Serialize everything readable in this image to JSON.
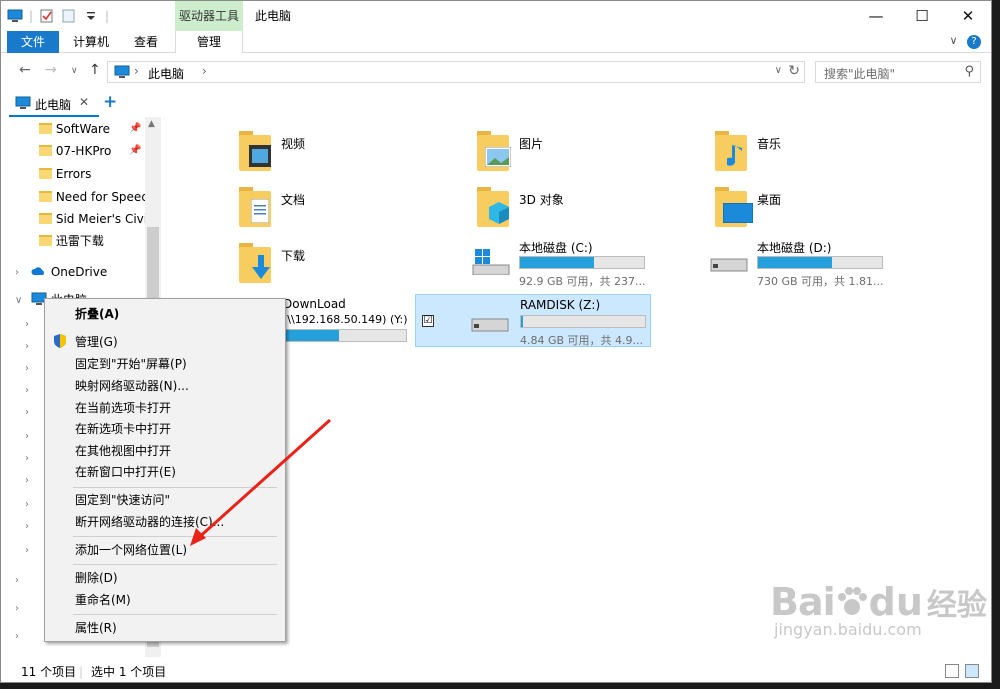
{
  "window": {
    "title": "此电脑",
    "context_tools_label": "驱动器工具",
    "caption": {
      "minimize": "—",
      "maximize": "☐",
      "close": "✕"
    }
  },
  "ribbon": {
    "tabs": [
      "文件",
      "计算机",
      "查看",
      "管理"
    ],
    "expand": "∨",
    "help": "?"
  },
  "address": {
    "back": "←",
    "forward": "→",
    "recent": "∨",
    "up": "↑",
    "path": "此电脑",
    "sep": "›",
    "dropdown": "∨",
    "refresh": "↻",
    "search_placeholder": "搜索\"此电脑\"",
    "search_icon": "⚲"
  },
  "tab": {
    "label": "此电脑",
    "close": "✕",
    "add": "+"
  },
  "navpane": {
    "quick_items": [
      "SoftWare",
      "07-HKPro",
      "Errors",
      "Need for Speed",
      "Sid Meier's Civil",
      "迅雷下载"
    ],
    "pinned": [
      true,
      true,
      false,
      false,
      false,
      false
    ],
    "onedrive": "OneDrive",
    "this_pc": "此电脑"
  },
  "content": {
    "folders": [
      {
        "name": "视频"
      },
      {
        "name": "图片"
      },
      {
        "name": "音乐"
      },
      {
        "name": "文档"
      },
      {
        "name": "3D 对象"
      },
      {
        "name": "桌面"
      },
      {
        "name": "下载"
      }
    ],
    "drives": [
      {
        "name": "本地磁盘 (C:)",
        "usage": "92.9 GB 可用，共 237...",
        "used_fraction": 0.6
      },
      {
        "name": "本地磁盘 (D:)",
        "usage": "730 GB 可用，共 1.81...",
        "used_fraction": 0.6
      },
      {
        "name": "DownLoad",
        "sub": "(\\\\192.168.50.149) (Y:)",
        "used_fraction": 0.45
      },
      {
        "name": "RAMDISK (Z:)",
        "usage": "4.84 GB 可用，共 4.9...",
        "used_fraction": 0.02
      }
    ],
    "checkmark": "☑"
  },
  "context_menu": {
    "items": [
      {
        "label": "折叠(A)",
        "bold": true
      },
      {
        "label": "管理(G)",
        "shield": true
      },
      {
        "label": "固定到\"开始\"屏幕(P)"
      },
      {
        "label": "映射网络驱动器(N)..."
      },
      {
        "label": "在当前选项卡打开"
      },
      {
        "label": "在新选项卡中打开"
      },
      {
        "label": "在其他视图中打开"
      },
      {
        "label": "在新窗口中打开(E)"
      },
      {
        "label": "固定到\"快速访问\""
      },
      {
        "label": "断开网络驱动器的连接(C)..."
      },
      {
        "label": "添加一个网络位置(L)"
      },
      {
        "label": "删除(D)"
      },
      {
        "label": "重命名(M)"
      },
      {
        "label": "属性(R)"
      }
    ]
  },
  "status": {
    "count": "11 个项目",
    "selected": "选中 1 个项目"
  },
  "colors": {
    "accent": "#1979ca",
    "bar_fill": "#26a0da",
    "selection": "#cce8ff",
    "arrow": "#e8231a",
    "context_tools_bg": "#cdeecd"
  },
  "watermark": {
    "brand": "Bai",
    "brand2": "du",
    "cn": "经验",
    "url": "jingyan.baidu.com"
  }
}
